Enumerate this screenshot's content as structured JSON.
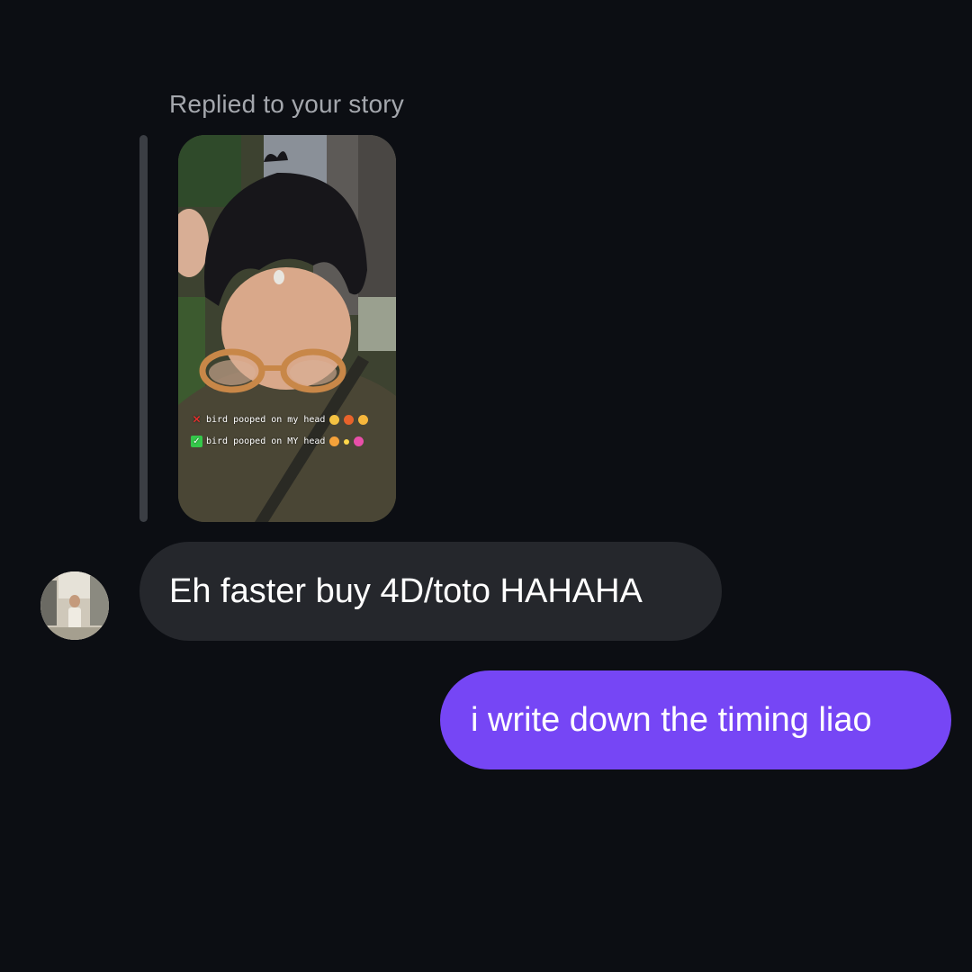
{
  "thread": {
    "reply_caption": "Replied to your story",
    "story": {
      "line1": "bird pooped on my head",
      "line2": "bird pooped on MY head"
    },
    "messages": [
      {
        "sender": "them",
        "text": "Eh faster buy 4D/toto HAHAHA"
      },
      {
        "sender": "me",
        "text": "i write down the timing liao"
      }
    ]
  },
  "colors": {
    "background": "#0c0e13",
    "incoming_bubble": "#25272c",
    "outgoing_bubble": "#7646f5",
    "caption_text": "#a4a7ad"
  },
  "icons": {
    "cross": "cross-mark-icon",
    "check": "check-mark-icon"
  }
}
